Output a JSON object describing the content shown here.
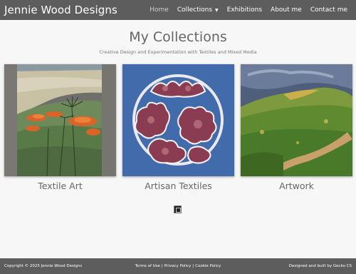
{
  "header": {
    "brand": "Jennie Wood Designs",
    "nav": [
      {
        "label": "Home",
        "active": true
      },
      {
        "label": "Collections",
        "has_dropdown": true
      },
      {
        "label": "Exhibitions"
      },
      {
        "label": "About me"
      },
      {
        "label": "Contact me"
      }
    ]
  },
  "main": {
    "title": "My Collections",
    "subtitle": "Creative Design and Experimentation with Textiles and Mixed Media",
    "cards": [
      {
        "label": "Textile Art"
      },
      {
        "label": "Artisan Textiles"
      },
      {
        "label": "Artwork"
      }
    ]
  },
  "footer": {
    "copyright": "Copyright © 2025 Jennie Wood Designs",
    "terms": "Terms of Use",
    "separator": "|",
    "privacy": "Privacy Policy",
    "cookie": "Cookie Policy",
    "credit": "Designed and built by Gecko CS"
  },
  "colors": {
    "header_bg": "#5d5d5d",
    "page_bg": "#f7f7f7",
    "text": "#666666"
  }
}
